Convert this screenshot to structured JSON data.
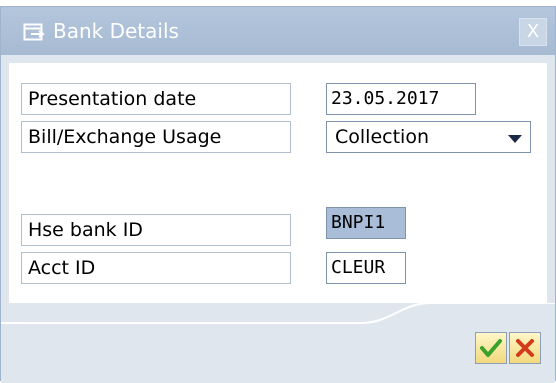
{
  "dialog": {
    "title": "Bank Details",
    "close_label": "X"
  },
  "fields": {
    "presentation_date": {
      "label": "Presentation date",
      "value": "23.05.2017"
    },
    "bill_exchange_usage": {
      "label": "Bill/Exchange Usage",
      "value": "Collection"
    },
    "hse_bank_id": {
      "label": "Hse bank ID",
      "value": "BNPI1"
    },
    "acct_id": {
      "label": "Acct ID",
      "value": "CLEUR"
    }
  },
  "colors": {
    "titlebar": "#aabcd4",
    "highlight_field": "#a9bdd8",
    "ok_check": "#3aa22a",
    "cancel_x": "#d33a1a"
  },
  "icons": {
    "title": "dialog-window-icon",
    "ok": "check-icon",
    "cancel": "cross-icon"
  }
}
